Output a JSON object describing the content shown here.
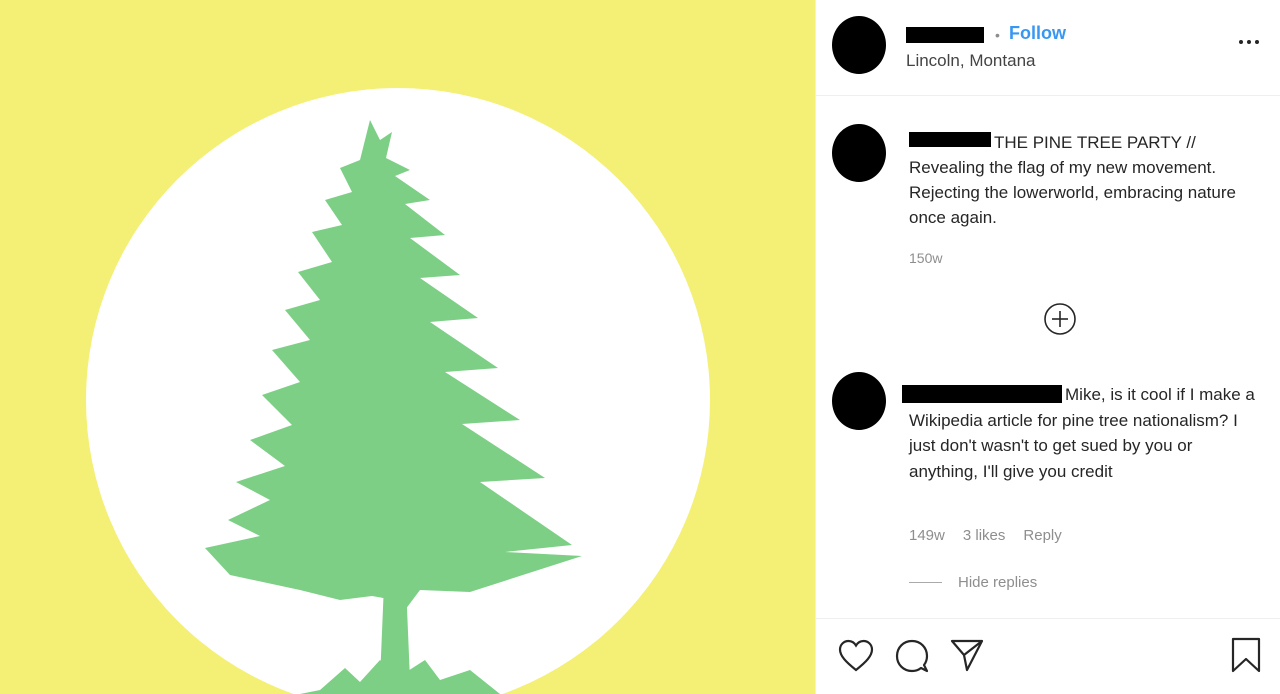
{
  "header": {
    "dot": "•",
    "follow_label": "Follow",
    "location": "Lincoln, Montana"
  },
  "caption": {
    "text": "THE PINE TREE PARTY // Revealing the flag of my new movement. Rejecting the lowerworld, embracing nature once again.",
    "time": "150w"
  },
  "comment": {
    "text": "Mike, is it cool if I make a Wikipedia article for pine tree nationalism? I just don't wasn't to get sued by you or anything, I'll give you credit",
    "time": "149w",
    "likes": "3 likes",
    "reply_label": "Reply",
    "hide_replies_label": "Hide replies"
  },
  "icons": {
    "like": "heart-icon",
    "comment": "comment-bubble-icon",
    "share": "paper-plane-icon",
    "save": "bookmark-icon",
    "more": "more-dots-icon",
    "load_more": "plus-circle-icon"
  },
  "colors": {
    "flag_background": "#f4ef75",
    "flag_circle": "#ffffff",
    "tree": "#7dcf86",
    "follow": "#3897f0"
  }
}
